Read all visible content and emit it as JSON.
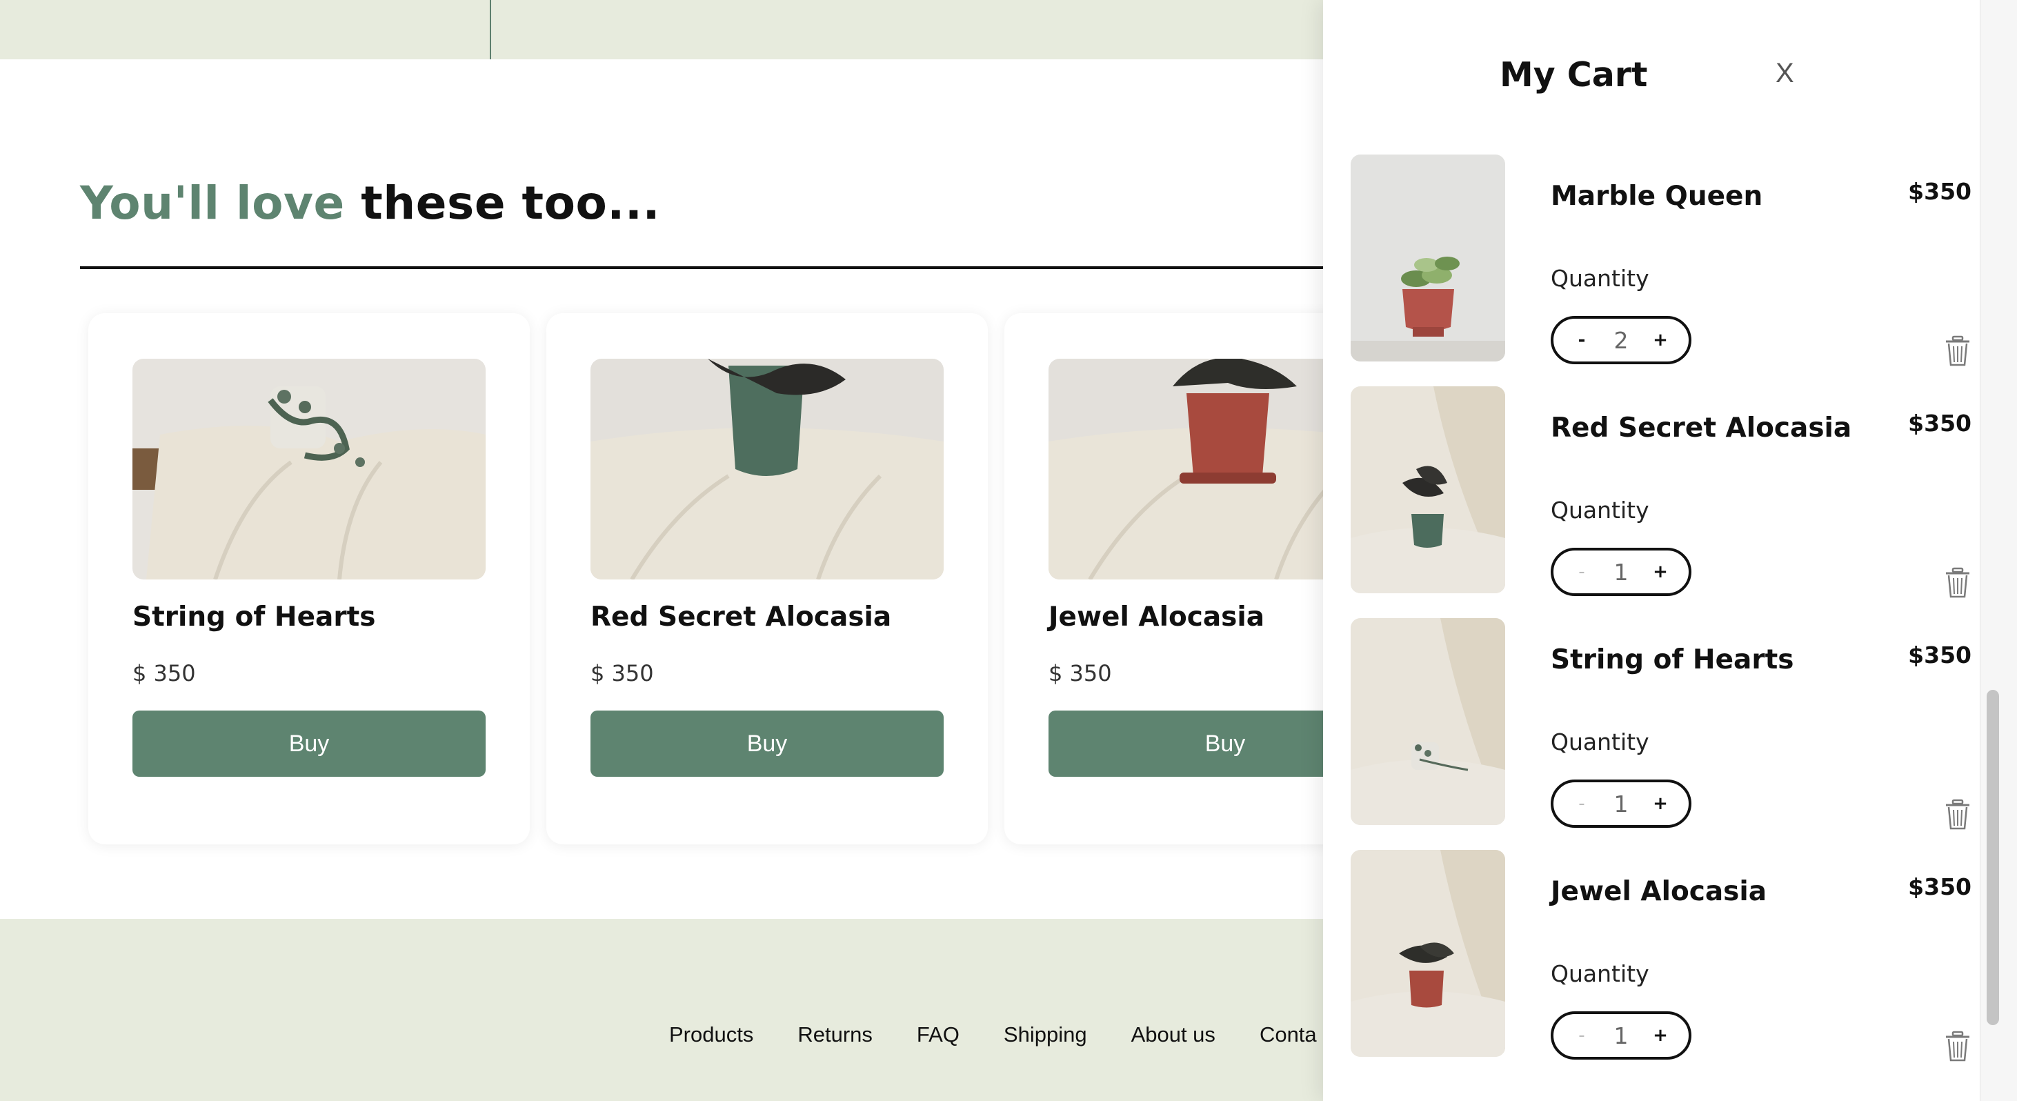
{
  "section": {
    "title_accent": "You'll love",
    "title_rest": "these too..."
  },
  "products": [
    {
      "name": "String of Hearts",
      "price": "$ 350",
      "buy_label": "Buy",
      "image": "white-pot-trailing-vine-photo"
    },
    {
      "name": "Red Secret Alocasia",
      "price": "$ 350",
      "buy_label": "Buy",
      "image": "green-pot-alocasia-photo"
    },
    {
      "name": "Jewel Alocasia",
      "price": "$ 350",
      "buy_label": "Buy",
      "image": "red-pot-alocasia-photo"
    }
  ],
  "footer": {
    "links": [
      "Products",
      "Returns",
      "FAQ",
      "Shipping",
      "About us",
      "Conta"
    ]
  },
  "cart": {
    "title": "My Cart",
    "close_label": "X",
    "quantity_label": "Quantity",
    "items": [
      {
        "name": "Marble Queen",
        "price": "$350",
        "quantity": "2",
        "minus": "-",
        "plus": "+",
        "image": "red-pot-pothos-photo"
      },
      {
        "name": "Red Secret Alocasia",
        "price": "$350",
        "quantity": "1",
        "minus": "-",
        "plus": "+",
        "image": "green-pot-alocasia-photo"
      },
      {
        "name": "String of Hearts",
        "price": "$350",
        "quantity": "1",
        "minus": "-",
        "plus": "+",
        "image": "white-pot-trailing-vine-photo"
      },
      {
        "name": "Jewel Alocasia",
        "price": "$350",
        "quantity": "1",
        "minus": "-",
        "plus": "+",
        "image": "red-pot-alocasia-photo"
      }
    ]
  },
  "colors": {
    "accent": "#5e8470",
    "band": "#e7ebdd"
  },
  "icons": {
    "delete": "trash-icon",
    "close": "close-icon"
  }
}
